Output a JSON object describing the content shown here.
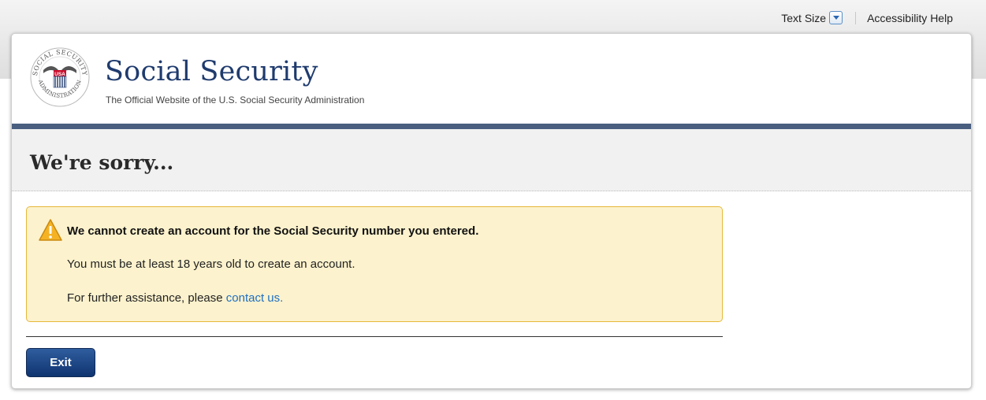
{
  "utility_bar": {
    "text_size_label": "Text Size",
    "accessibility_help": "Accessibility Help"
  },
  "header": {
    "site_title": "Social Security",
    "subtitle": "The Official Website of the U.S. Social Security Administration",
    "seal_text_top": "SOCIAL SECURITY",
    "seal_text_bottom": "ADMINISTRATION",
    "seal_center": "USA"
  },
  "page": {
    "title": "We're sorry..."
  },
  "alert": {
    "heading": "We cannot create an account for the Social Security number you entered.",
    "message": "You must be at least 18 years old to create an account.",
    "assistance_prefix": "For further assistance, please ",
    "contact_link": "contact us."
  },
  "actions": {
    "exit_label": "Exit"
  },
  "colors": {
    "brand_navy": "#1f3b6e",
    "header_bar": "#4a5f80",
    "alert_background": "#fcf2cd",
    "alert_border": "#e6b93a",
    "link": "#1f6fc1",
    "button": "#1a447f"
  },
  "icons": {
    "text_size_toggle": "chevron-down-icon",
    "alert": "warning-icon",
    "logo": "ssa-seal-icon"
  }
}
